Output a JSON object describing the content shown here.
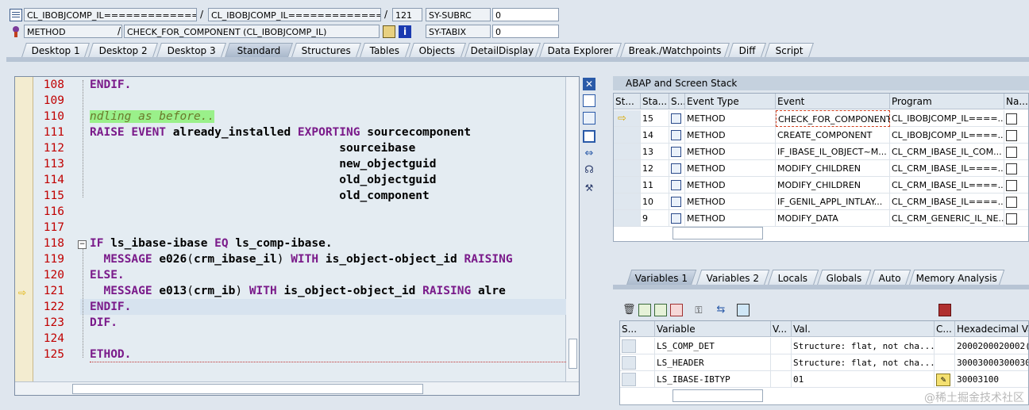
{
  "header": {
    "row1": {
      "program1": "CL_IBOBJCOMP_IL===============",
      "sep1": "/",
      "program2": "CL_IBOBJCOMP_IL===============",
      "sep2": "/",
      "line": "121",
      "sysvar": "SY-SUBRC",
      "sysval": "0"
    },
    "row2": {
      "type": "METHOD",
      "sep": "/",
      "event": "CHECK_FOR_COMPONENT (CL_IBOBJCOMP_IL)",
      "sysvar": "SY-TABIX",
      "sysval": "0"
    }
  },
  "tabs": [
    {
      "label": "Desktop 1"
    },
    {
      "label": "Desktop 2"
    },
    {
      "label": "Desktop 3"
    },
    {
      "label": "Standard"
    },
    {
      "label": "Structures"
    },
    {
      "label": "Tables"
    },
    {
      "label": "Objects"
    },
    {
      "label": "DetailDisplay"
    },
    {
      "label": "Data Explorer"
    },
    {
      "label": "Break./Watchpoints"
    },
    {
      "label": "Diff"
    },
    {
      "label": "Script"
    }
  ],
  "editor": {
    "lines": [
      {
        "num": "108",
        "parts": [
          [
            "kw",
            "ENDIF."
          ]
        ]
      },
      {
        "num": "109",
        "parts": []
      },
      {
        "num": "110",
        "parts": [
          [
            "cm",
            "ndling as before.."
          ]
        ]
      },
      {
        "num": "111",
        "parts": [
          [
            "kw",
            "RAISE EVENT "
          ],
          [
            "n",
            "already_installed "
          ],
          [
            "kw",
            "EXPORTING "
          ],
          [
            "n",
            "sourcecomponent"
          ]
        ]
      },
      {
        "num": "112",
        "parts": [
          [
            "n",
            "                                    sourceibase"
          ]
        ]
      },
      {
        "num": "113",
        "parts": [
          [
            "n",
            "                                    new_objectguid"
          ]
        ]
      },
      {
        "num": "114",
        "parts": [
          [
            "n",
            "                                    old_objectguid"
          ]
        ]
      },
      {
        "num": "115",
        "parts": [
          [
            "n",
            "                                    old_component"
          ]
        ]
      },
      {
        "num": "116",
        "parts": []
      },
      {
        "num": "117",
        "parts": []
      },
      {
        "num": "118",
        "parts": [
          [
            "kw",
            "IF "
          ],
          [
            "n",
            "ls_ibase-ibase "
          ],
          [
            "kw",
            "EQ "
          ],
          [
            "n",
            "ls_comp-ibase."
          ]
        ]
      },
      {
        "num": "119",
        "parts": [
          [
            "kw",
            "  MESSAGE "
          ],
          [
            "n",
            "e026"
          ],
          [
            "pl",
            "("
          ],
          [
            "n",
            "crm_ibase_il"
          ],
          [
            "pl",
            ") "
          ],
          [
            "kw",
            "WITH "
          ],
          [
            "n",
            "is_object-object_id "
          ],
          [
            "kw",
            "RAISING"
          ]
        ]
      },
      {
        "num": "120",
        "parts": [
          [
            "kw",
            "ELSE."
          ]
        ]
      },
      {
        "num": "121",
        "parts": [
          [
            "kw",
            "  MESSAGE "
          ],
          [
            "n",
            "e013"
          ],
          [
            "pl",
            "("
          ],
          [
            "n",
            "crm_ib"
          ],
          [
            "pl",
            ") "
          ],
          [
            "kw",
            "WITH "
          ],
          [
            "n",
            "is_object-object_id "
          ],
          [
            "kw",
            "RAISING "
          ],
          [
            "n",
            "alre"
          ]
        ]
      },
      {
        "num": "122",
        "parts": [
          [
            "kw",
            "ENDIF."
          ]
        ]
      },
      {
        "num": "123",
        "parts": [
          [
            "kw",
            "DIF."
          ]
        ]
      },
      {
        "num": "124",
        "parts": []
      },
      {
        "num": "125",
        "parts": [
          [
            "kw",
            "ETHOD."
          ]
        ]
      }
    ]
  },
  "stack": {
    "title": "ABAP and Screen Stack",
    "headers": [
      "St...",
      "Sta...",
      "S...",
      "Event Type",
      "Event",
      "Program",
      "Na..."
    ],
    "rows": [
      {
        "level": "15",
        "type": "METHOD",
        "event": "CHECK_FOR_COMPONENT",
        "program": "CL_IBOBJCOMP_IL====..."
      },
      {
        "level": "14",
        "type": "METHOD",
        "event": "CREATE_COMPONENT",
        "program": "CL_IBOBJCOMP_IL====..."
      },
      {
        "level": "13",
        "type": "METHOD",
        "event": "IF_IBASE_IL_OBJECT~M...",
        "program": "CL_CRM_IBASE_IL_COM..."
      },
      {
        "level": "12",
        "type": "METHOD",
        "event": "MODIFY_CHILDREN",
        "program": "CL_CRM_IBASE_IL====..."
      },
      {
        "level": "11",
        "type": "METHOD",
        "event": "MODIFY_CHILDREN",
        "program": "CL_CRM_IBASE_IL====..."
      },
      {
        "level": "10",
        "type": "METHOD",
        "event": "IF_GENIL_APPL_INTLAY...",
        "program": "CL_CRM_IBASE_IL====..."
      },
      {
        "level": "9",
        "type": "METHOD",
        "event": "MODIFY_DATA",
        "program": "CL_CRM_GENERIC_IL_NE..."
      }
    ]
  },
  "vartabs": [
    {
      "label": "Variables 1"
    },
    {
      "label": "Variables 2"
    },
    {
      "label": "Locals"
    },
    {
      "label": "Globals"
    },
    {
      "label": "Auto"
    },
    {
      "label": "Memory Analysis"
    }
  ],
  "vars": {
    "headers": [
      "S...",
      "Variable",
      "V...",
      "Val.",
      "C...",
      "Hexadecimal Valu"
    ],
    "rows": [
      {
        "name": "LS_COMP_DET",
        "val": "Structure: flat, not cha...",
        "hex": "2000200020002("
      },
      {
        "name": "LS_HEADER",
        "val": "Structure: flat, not cha...",
        "hex": "30003000300030"
      },
      {
        "name": "LS_IBASE-IBTYP",
        "val": "01",
        "hex": "30003100"
      }
    ]
  },
  "watermark": "@稀土掘金技术社区"
}
